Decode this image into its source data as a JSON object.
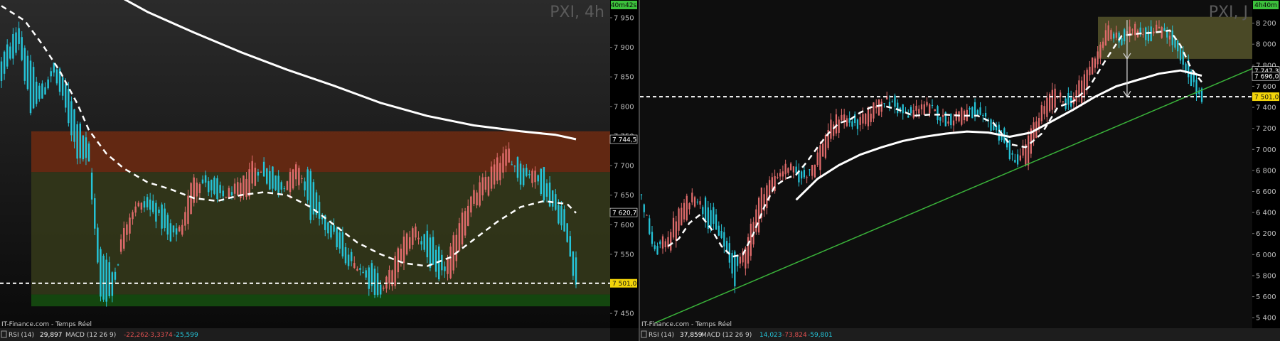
{
  "colors": {
    "bull": "#25c4d8",
    "bear": "#e06b6b",
    "ma_white": "#ffffff",
    "trendline": "#3ab33a",
    "current_price_bg": "#f2d40a",
    "timer_bg": "#3cc23c",
    "zone_red": "#6a2a12",
    "zone_olive": "#33371a",
    "zone_green": "#154d10",
    "zone_khaki": "#55532a"
  },
  "chart_data": [
    {
      "type": "candlestick",
      "instrument": "PXI, 4h",
      "timer": "40m42s",
      "ylim": [
        7425,
        7980
      ],
      "y_ticks": [
        7450,
        7500,
        7550,
        7600,
        7650,
        7700,
        7750,
        7800,
        7850,
        7900,
        7950
      ],
      "y_tick_labels": [
        "7 450",
        "7 500",
        "7 550",
        "7 600",
        "7 650",
        "7 700",
        "7 750",
        "7 800",
        "7 850",
        "7 900",
        "7 950"
      ],
      "price_tags": [
        {
          "value": 7744.5,
          "label": "7 744,5",
          "style": "white"
        },
        {
          "value": 7620.7,
          "label": "7 620,7",
          "style": "white"
        },
        {
          "value": 7501.0,
          "label": "7 501,0",
          "style": "yellow"
        }
      ],
      "zones": [
        {
          "from": 7689,
          "to": 7758,
          "color": "zone_red"
        },
        {
          "from": 7482,
          "to": 7689,
          "color": "zone_olive"
        },
        {
          "from": 7462,
          "to": 7482,
          "color": "zone_green"
        }
      ],
      "dashed_level": 7501,
      "anchors": [
        [
          0,
          7840,
          7880
        ],
        [
          6,
          7910,
          7935
        ],
        [
          10,
          7790,
          7870
        ],
        [
          14,
          7815,
          7830
        ],
        [
          18,
          7855,
          7870
        ],
        [
          22,
          7795,
          7840
        ],
        [
          26,
          7720,
          7775
        ],
        [
          30,
          7705,
          7730
        ],
        [
          34,
          7475,
          7560
        ],
        [
          38,
          7480,
          7520
        ],
        [
          42,
          7600,
          7560
        ],
        [
          46,
          7635,
          7620
        ],
        [
          50,
          7628,
          7650
        ],
        [
          54,
          7610,
          7635
        ],
        [
          58,
          7570,
          7600
        ],
        [
          62,
          7605,
          7575
        ],
        [
          66,
          7685,
          7640
        ],
        [
          70,
          7665,
          7685
        ],
        [
          74,
          7640,
          7670
        ],
        [
          78,
          7655,
          7645
        ],
        [
          82,
          7665,
          7648
        ],
        [
          86,
          7705,
          7660
        ],
        [
          90,
          7680,
          7705
        ],
        [
          94,
          7655,
          7685
        ],
        [
          98,
          7675,
          7660
        ],
        [
          102,
          7700,
          7675
        ],
        [
          106,
          7615,
          7690
        ],
        [
          110,
          7600,
          7620
        ],
        [
          114,
          7580,
          7605
        ],
        [
          118,
          7530,
          7570
        ],
        [
          122,
          7535,
          7525
        ],
        [
          126,
          7500,
          7535
        ],
        [
          130,
          7480,
          7505
        ],
        [
          134,
          7530,
          7490
        ],
        [
          138,
          7575,
          7545
        ],
        [
          142,
          7595,
          7580
        ],
        [
          146,
          7545,
          7580
        ],
        [
          150,
          7500,
          7560
        ],
        [
          154,
          7555,
          7505
        ],
        [
          158,
          7625,
          7565
        ],
        [
          162,
          7650,
          7630
        ],
        [
          166,
          7680,
          7650
        ],
        [
          170,
          7705,
          7680
        ],
        [
          174,
          7725,
          7700
        ],
        [
          178,
          7670,
          7710
        ],
        [
          182,
          7695,
          7675
        ],
        [
          186,
          7650,
          7690
        ],
        [
          190,
          7625,
          7645
        ],
        [
          194,
          7570,
          7610
        ],
        [
          197,
          7500,
          7540
        ]
      ],
      "ma_dashed": [
        [
          0,
          7970
        ],
        [
          8,
          7945
        ],
        [
          14,
          7905
        ],
        [
          20,
          7860
        ],
        [
          26,
          7805
        ],
        [
          30,
          7760
        ],
        [
          36,
          7720
        ],
        [
          42,
          7695
        ],
        [
          50,
          7672
        ],
        [
          58,
          7660
        ],
        [
          66,
          7645
        ],
        [
          74,
          7640
        ],
        [
          82,
          7650
        ],
        [
          90,
          7655
        ],
        [
          98,
          7650
        ],
        [
          106,
          7630
        ],
        [
          114,
          7600
        ],
        [
          122,
          7570
        ],
        [
          130,
          7550
        ],
        [
          138,
          7535
        ],
        [
          146,
          7530
        ],
        [
          154,
          7545
        ],
        [
          162,
          7575
        ],
        [
          170,
          7605
        ],
        [
          178,
          7630
        ],
        [
          186,
          7640
        ],
        [
          194,
          7635
        ],
        [
          197,
          7620
        ]
      ],
      "ma_solid": [
        [
          36,
          7998
        ],
        [
          50,
          7960
        ],
        [
          66,
          7925
        ],
        [
          82,
          7892
        ],
        [
          98,
          7862
        ],
        [
          114,
          7835
        ],
        [
          130,
          7806
        ],
        [
          146,
          7784
        ],
        [
          162,
          7768
        ],
        [
          178,
          7758
        ],
        [
          190,
          7752
        ],
        [
          197,
          7744.5
        ]
      ],
      "indicator_text": {
        "source": "IT-Finance.com - Temps Réel",
        "rsi_label": "RSI (14)",
        "rsi_value": "29,897",
        "macd_label": "MACD (12 26 9)",
        "macd_1": "-22,262",
        "macd_2": "-3,3374",
        "macd_3": "-25,599"
      }
    },
    {
      "type": "candlestick",
      "instrument": "PXI, J",
      "timer": "4h40m",
      "ylim": [
        5300,
        8420
      ],
      "y_ticks": [
        5400,
        5600,
        5800,
        6000,
        6200,
        6400,
        6600,
        6800,
        7000,
        7200,
        7400,
        7600,
        7800,
        8000,
        8200
      ],
      "y_tick_labels": [
        "5 400",
        "5 600",
        "5 800",
        "6 000",
        "6 200",
        "6 400",
        "6 600",
        "6 800",
        "7 000",
        "7 200",
        "7 400",
        "7 600",
        "7 800",
        "8 000",
        "8 200"
      ],
      "price_tags": [
        {
          "value": 7747.3,
          "label": "7 747,3",
          "style": "white"
        },
        {
          "value": 7696.0,
          "label": "7 696,0",
          "style": "white"
        },
        {
          "value": 7501.0,
          "label": "7 501,0",
          "style": "yellow"
        }
      ],
      "zones": [
        {
          "from": 7860,
          "to": 8260,
          "color": "zone_khaki"
        }
      ],
      "dashed_level": 7501,
      "trendline": [
        [
          5,
          5350
        ],
        [
          200,
          7700
        ]
      ],
      "arrow": {
        "x": 182,
        "from": 8230,
        "to": 7500
      },
      "anchors": [
        [
          0,
          6550,
          6600
        ],
        [
          5,
          6000,
          6100
        ],
        [
          10,
          6200,
          6050
        ],
        [
          15,
          6450,
          6250
        ],
        [
          20,
          6600,
          6500
        ],
        [
          25,
          6300,
          6500
        ],
        [
          30,
          6150,
          6250
        ],
        [
          35,
          5750,
          6000
        ],
        [
          40,
          6200,
          5900
        ],
        [
          45,
          6600,
          6350
        ],
        [
          50,
          6750,
          6650
        ],
        [
          55,
          6850,
          6800
        ],
        [
          60,
          6700,
          6800
        ],
        [
          65,
          6900,
          6750
        ],
        [
          70,
          7200,
          7000
        ],
        [
          75,
          7350,
          7250
        ],
        [
          80,
          7200,
          7300
        ],
        [
          85,
          7350,
          7250
        ],
        [
          90,
          7500,
          7400
        ],
        [
          95,
          7400,
          7500
        ],
        [
          100,
          7300,
          7350
        ],
        [
          105,
          7450,
          7350
        ],
        [
          110,
          7350,
          7400
        ],
        [
          115,
          7250,
          7300
        ],
        [
          120,
          7400,
          7250
        ],
        [
          125,
          7300,
          7400
        ],
        [
          130,
          7250,
          7300
        ],
        [
          135,
          7100,
          7200
        ],
        [
          140,
          6850,
          6950
        ],
        [
          145,
          7100,
          6900
        ],
        [
          150,
          7400,
          7250
        ],
        [
          155,
          7550,
          7450
        ],
        [
          160,
          7400,
          7500
        ],
        [
          165,
          7650,
          7450
        ],
        [
          170,
          7900,
          7800
        ],
        [
          175,
          8150,
          8050
        ],
        [
          180,
          8000,
          8100
        ],
        [
          185,
          8200,
          8100
        ],
        [
          190,
          8050,
          8150
        ],
        [
          195,
          8200,
          8100
        ],
        [
          200,
          7950,
          8100
        ],
        [
          205,
          7650,
          7800
        ],
        [
          210,
          7500,
          7550
        ]
      ],
      "ma_dashed": [
        [
          10,
          6080
        ],
        [
          14,
          6150
        ],
        [
          18,
          6300
        ],
        [
          22,
          6380
        ],
        [
          26,
          6250
        ],
        [
          30,
          6080
        ],
        [
          34,
          5980
        ],
        [
          38,
          6000
        ],
        [
          42,
          6200
        ],
        [
          46,
          6450
        ],
        [
          50,
          6650
        ],
        [
          54,
          6720
        ],
        [
          58,
          6760
        ],
        [
          62,
          6880
        ],
        [
          66,
          7020
        ],
        [
          70,
          7150
        ],
        [
          74,
          7250
        ],
        [
          78,
          7280
        ],
        [
          82,
          7350
        ],
        [
          86,
          7400
        ],
        [
          90,
          7420
        ],
        [
          96,
          7380
        ],
        [
          102,
          7320
        ],
        [
          108,
          7330
        ],
        [
          114,
          7330
        ],
        [
          120,
          7320
        ],
        [
          126,
          7320
        ],
        [
          132,
          7250
        ],
        [
          138,
          7050
        ],
        [
          144,
          7020
        ],
        [
          150,
          7150
        ],
        [
          156,
          7400
        ],
        [
          162,
          7460
        ],
        [
          168,
          7600
        ],
        [
          174,
          7850
        ],
        [
          180,
          8080
        ],
        [
          186,
          8100
        ],
        [
          192,
          8110
        ],
        [
          198,
          8130
        ],
        [
          202,
          7990
        ],
        [
          206,
          7770
        ],
        [
          210,
          7640
        ]
      ],
      "ma_solid": [
        [
          58,
          6520
        ],
        [
          66,
          6720
        ],
        [
          74,
          6850
        ],
        [
          82,
          6950
        ],
        [
          90,
          7020
        ],
        [
          98,
          7080
        ],
        [
          106,
          7120
        ],
        [
          114,
          7150
        ],
        [
          122,
          7170
        ],
        [
          130,
          7160
        ],
        [
          138,
          7120
        ],
        [
          146,
          7160
        ],
        [
          154,
          7270
        ],
        [
          162,
          7380
        ],
        [
          170,
          7500
        ],
        [
          178,
          7600
        ],
        [
          186,
          7660
        ],
        [
          194,
          7720
        ],
        [
          202,
          7750
        ],
        [
          210,
          7700
        ]
      ],
      "indicator_text": {
        "source": "IT-Finance.com - Temps Réel",
        "rsi_label": "RSI (14)",
        "rsi_value": "37,859",
        "macd_label": "MACD (12 26 9)",
        "macd_1": "14,023",
        "macd_2": "-73,824",
        "macd_3": "-59,801"
      }
    }
  ]
}
